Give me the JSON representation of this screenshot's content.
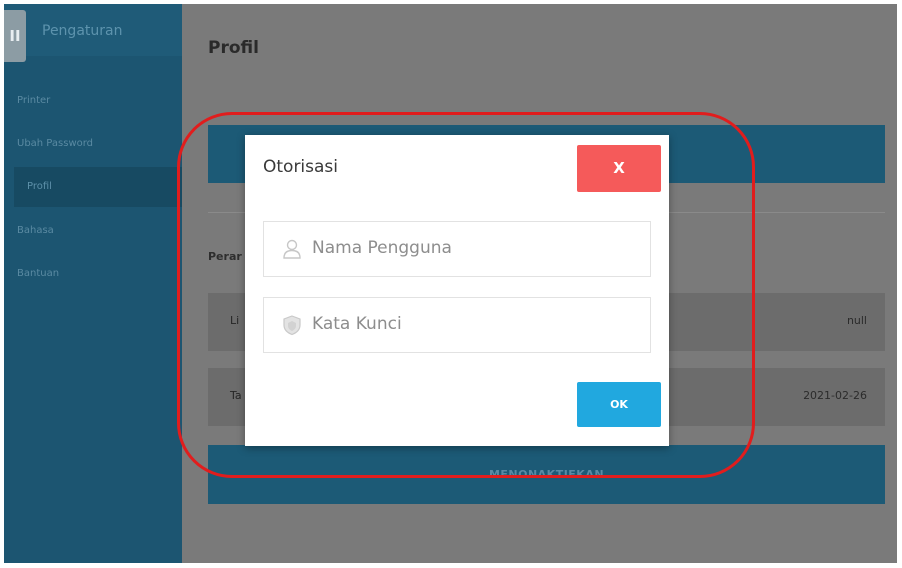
{
  "sidebar": {
    "toggle_glyph": "II",
    "title": "Pengaturan",
    "items": [
      {
        "label": "Printer"
      },
      {
        "label": "Ubah Password"
      },
      {
        "label": "Profil",
        "active": true
      },
      {
        "label": "Bahasa"
      },
      {
        "label": "Bantuan"
      }
    ]
  },
  "main": {
    "title": "Profil",
    "section_label_partial": "Perar",
    "rows": [
      {
        "label_partial": "Li",
        "value": "null"
      },
      {
        "label_partial": "Ta",
        "value": "2021-02-26"
      }
    ],
    "deactivate_label": "MENONAKTIFKAN"
  },
  "modal": {
    "title": "Otorisasi",
    "close_label": "X",
    "username_placeholder": "Nama Pengguna",
    "username_icon": "user-icon",
    "password_placeholder": "Kata Kunci",
    "password_icon": "shield-icon",
    "ok_label": "OK"
  },
  "colors": {
    "sidebar_bg": "#1c5571",
    "accent_blue": "#1c5a76",
    "close_red": "#f55a5a",
    "ok_blue": "#21a8df",
    "highlight_red": "#e11d1d"
  }
}
